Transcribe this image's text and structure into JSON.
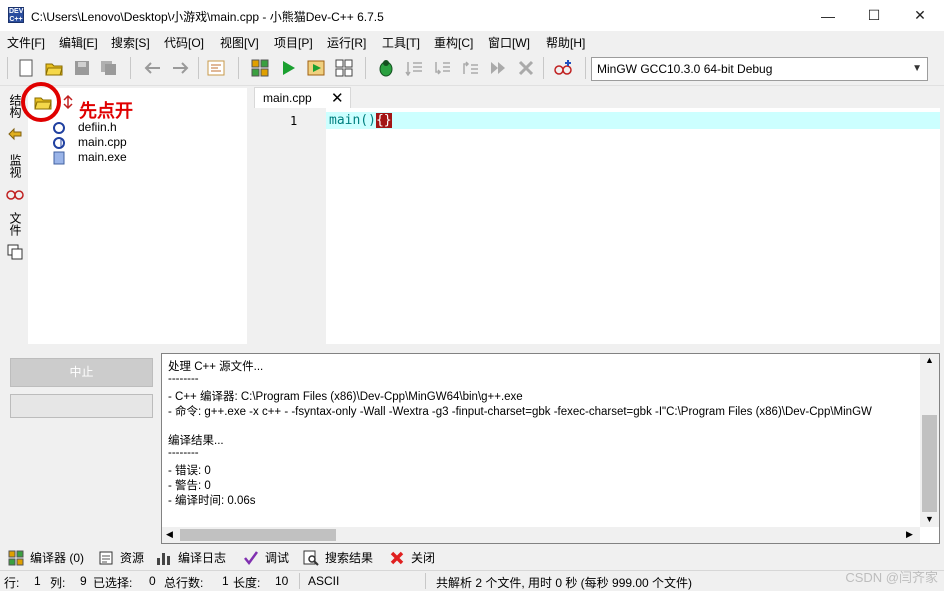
{
  "window": {
    "title": "C:\\Users\\Lenovo\\Desktop\\小游戏\\main.cpp - 小熊猫Dev-C++ 6.7.5",
    "app_icon_text": "DEV C++",
    "minimize": "—",
    "maximize": "☐",
    "close": "✕"
  },
  "menu": [
    "文件[F]",
    "编辑[E]",
    "搜索[S]",
    "代码[O]",
    "视图[V]",
    "项目[P]",
    "运行[R]",
    "工具[T]",
    "重构[C]",
    "窗口[W]",
    "帮助[H]"
  ],
  "toolbar": {
    "compiler": "MinGW GCC10.3.0 64-bit Debug"
  },
  "left_panel": {
    "tabs": [
      "结构",
      "监视",
      "文件"
    ],
    "files": [
      {
        "name": "defiin.h",
        "icon": "header-file-icon"
      },
      {
        "name": "main.cpp",
        "icon": "cpp-file-icon"
      },
      {
        "name": "main.exe",
        "icon": "exe-file-icon"
      }
    ]
  },
  "editor": {
    "tab_label": "main.cpp",
    "tab_close": "✕",
    "line_number": "1",
    "code_prefix": "main()",
    "code_brace": "{}"
  },
  "bottom": {
    "abort_label": "中止",
    "log_lines": [
      "处理 C++ 源文件...",
      "--------",
      "- C++ 编译器: C:\\Program Files (x86)\\Dev-Cpp\\MinGW64\\bin\\g++.exe",
      "- 命令: g++.exe -x c++ - -fsyntax-only -Wall -Wextra -g3 -finput-charset=gbk -fexec-charset=gbk -I\"C:\\Program Files (x86)\\Dev-Cpp\\MinGW",
      "",
      "编译结果...",
      "--------",
      "- 错误: 0",
      "- 警告: 0",
      "- 编译时间: 0.06s"
    ],
    "tabs": [
      {
        "label": "编译器 (0)",
        "icon": "compiler-icon"
      },
      {
        "label": "资源",
        "icon": "resource-icon"
      },
      {
        "label": "编译日志",
        "icon": "chart-icon"
      },
      {
        "label": "调试",
        "icon": "debug-check-icon"
      },
      {
        "label": "搜索结果",
        "icon": "search-result-icon"
      },
      {
        "label": "关闭",
        "icon": "close-red-icon"
      }
    ]
  },
  "status": {
    "row_label": "行:",
    "row": "1",
    "col_label": "列:",
    "col": "9",
    "selected_label": "已选择:",
    "selected": "0",
    "total_lines_label": "总行数:",
    "total_lines": "1",
    "length_label": "长度:",
    "length": "10",
    "encoding": "ASCII",
    "parse_info": "共解析 2 个文件, 用时 0 秒 (每秒 999.00 个文件)"
  },
  "annotation": {
    "text": "先点开"
  },
  "watermark": "CSDN @闫齐家",
  "colors": {
    "line_highlight": "#ccffff",
    "code_text": "#008080",
    "brace_bg": "#a31515",
    "annotation": "#e00000"
  }
}
